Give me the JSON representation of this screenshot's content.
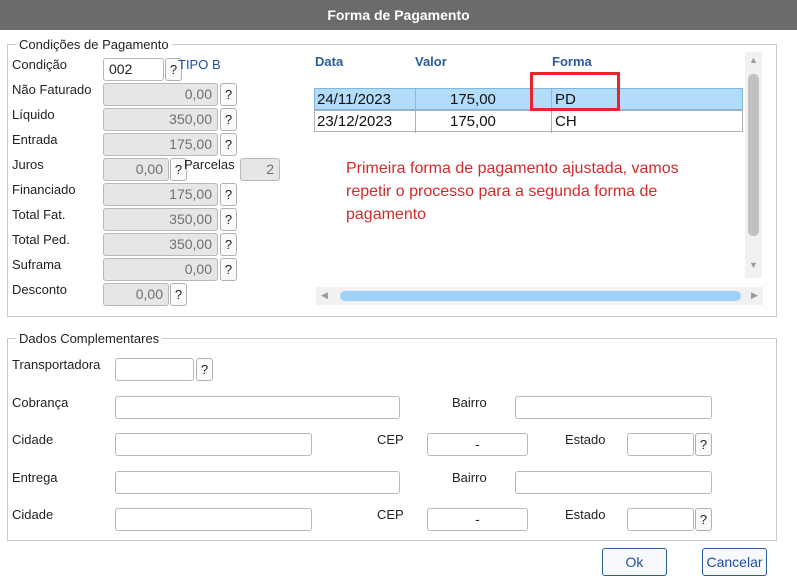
{
  "window": {
    "title": "Forma de Pagamento"
  },
  "condicoes": {
    "legend": "Condições de Pagamento",
    "condicao_label": "Condição",
    "condicao_value": "002",
    "condicao_desc": "TIPO B",
    "nao_faturado_label": "Não Faturado",
    "nao_faturado_value": "0,00",
    "liquido_label": "Líquido",
    "liquido_value": "350,00",
    "entrada_label": "Entrada",
    "entrada_value": "175,00",
    "juros_label": "Juros",
    "juros_value": "0,00",
    "parcelas_label": "Parcelas",
    "parcelas_value": "2",
    "financiado_label": "Financiado",
    "financiado_value": "175,00",
    "total_fat_label": "Total Fat.",
    "total_fat_value": "350,00",
    "total_ped_label": "Total Ped.",
    "total_ped_value": "350,00",
    "suframa_label": "Suframa",
    "suframa_value": "0,00",
    "desconto_label": "Desconto",
    "desconto_value": "0,00",
    "help_label": "?"
  },
  "grid": {
    "headers": {
      "data": "Data",
      "valor": "Valor",
      "forma": "Forma"
    },
    "rows": [
      {
        "data": "24/11/2023",
        "valor": "175,00",
        "forma": "PD"
      },
      {
        "data": "23/12/2023",
        "valor": "175,00",
        "forma": "CH"
      }
    ]
  },
  "annotation": {
    "line1": "Primeira forma de pagamento ajustada, vamos",
    "line2": "repetir o processo para a segunda forma de",
    "line3": "pagamento",
    "highlight_color": "#e8232a"
  },
  "complementares": {
    "legend": "Dados Complementares",
    "transportadora_label": "Transportadora",
    "cobranca_label": "Cobrança",
    "bairro1_label": "Bairro",
    "cidade1_label": "Cidade",
    "cep1_label": "CEP",
    "cep1_value": "-",
    "estado1_label": "Estado",
    "entrega_label": "Entrega",
    "bairro2_label": "Bairro",
    "cidade2_label": "Cidade",
    "cep2_label": "CEP",
    "cep2_value": "-",
    "estado2_label": "Estado"
  },
  "buttons": {
    "ok": "Ok",
    "cancelar": "Cancelar"
  },
  "colors": {
    "titlebar": "#6b6b6b",
    "selected_row": "#b3dcfa",
    "annotation_text": "#d22b2b",
    "scroll_thumb": "#9fd0f5"
  }
}
